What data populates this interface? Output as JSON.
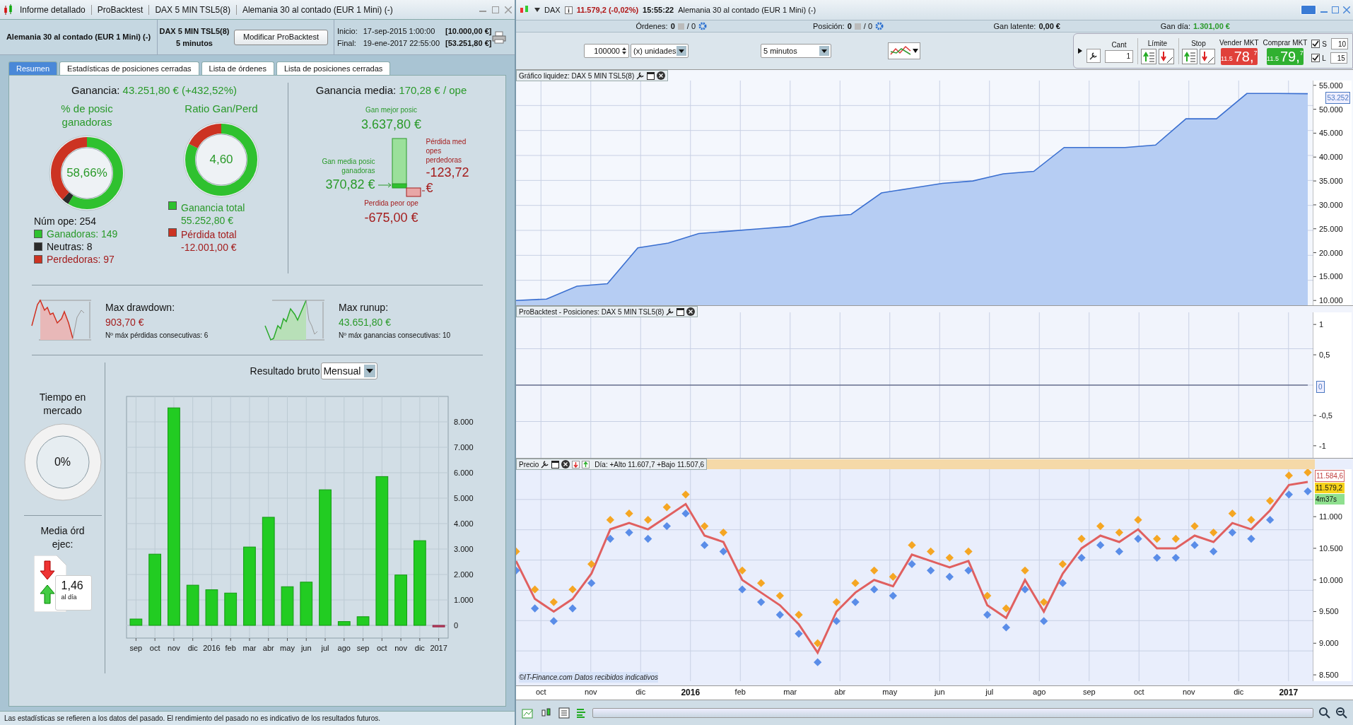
{
  "left_window": {
    "title_parts": [
      "Informe detallado",
      "ProBacktest",
      "DAX 5 MIN TSL5(8)",
      "Alemania 30 al contado (EUR 1 Mini) (-)"
    ],
    "instrument": "Alemania 30 al contado (EUR 1 Mini) (-)",
    "strategy": "DAX 5 MIN TSL5(8)",
    "timeframe": "5 minutos",
    "modify_button": "Modificar ProBacktest",
    "start_label": "Inicio:",
    "start_date": "17-sep-2015 1:00:00",
    "start_capital": "[10.000,00 €]",
    "end_label": "Final:",
    "end_date": "19-ene-2017 22:55:00",
    "end_capital": "[53.251,80 €]",
    "tabs": [
      {
        "label": "Resumen",
        "selected": true
      },
      {
        "label": "Estadísticas de posiciones cerradas",
        "selected": false
      },
      {
        "label": "Lista de órdenes",
        "selected": false
      },
      {
        "label": "Lista de posiciones cerradas",
        "selected": false
      }
    ],
    "summary": {
      "gain_label": "Ganancia:",
      "gain_value": "43.251,80 € (+432,52%)",
      "win_pct": {
        "title": "% de posic ganadoras",
        "value": "58,66%",
        "segments": [
          {
            "kind": "win",
            "level": 0.5866
          },
          {
            "kind": "neutral",
            "level": 0.0315
          },
          {
            "kind": "loss",
            "level": 0.3819
          }
        ]
      },
      "ratio": {
        "title": "Ratio Gan/Perd",
        "value": "4,60",
        "segments": [
          {
            "kind": "win",
            "level": 0.8216
          },
          {
            "kind": "loss",
            "level": 0.1784
          }
        ]
      },
      "trades_label": "Núm ope: 254",
      "legend_counts": [
        {
          "kind": "win",
          "label": "Ganadoras: 149"
        },
        {
          "kind": "neutral",
          "label": "Neutras: 8"
        },
        {
          "kind": "loss",
          "label": "Perdedoras: 97"
        }
      ],
      "legend_totals": [
        {
          "kind": "win",
          "label": "Ganancia total",
          "value": "55.252,80 €"
        },
        {
          "kind": "loss",
          "label": "Pérdida total",
          "value": "-12.001,00 €"
        }
      ],
      "avg_gain_label": "Ganancia media:",
      "avg_gain_value": "170,28 € / ope",
      "best_label": "Gan mejor posic",
      "best_value": "3.637,80 €",
      "avg_win_label": "Gan media posic ganadoras",
      "avg_win_value": "370,82 €",
      "avg_loss_label": "Pérdida med opes perdedoras",
      "avg_loss_value": "-123,72 €",
      "worst_label": "Perdida peor ope",
      "worst_value": "-675,00 €",
      "drawdown": {
        "label": "Max drawdown:",
        "value": "903,70 €",
        "note": "Nº máx pérdidas consecutivas: 6"
      },
      "runup": {
        "label": "Max runup:",
        "value": "43.651,80 €",
        "note": "Nº máx ganancias consecutivas: 10"
      },
      "time_in_market": {
        "title": "Tiempo en mercado",
        "value": "0%",
        "level": 0
      },
      "orders_per_day": {
        "title": "Media órd ejec:",
        "value": "1,46",
        "unit": "al día"
      },
      "result": {
        "label": "Resultado bruto",
        "period": "Mensual",
        "chart_data": {
          "type": "bar",
          "categories": [
            "sep",
            "oct",
            "nov",
            "dic",
            "2016",
            "feb",
            "mar",
            "abr",
            "may",
            "jun",
            "jul",
            "ago",
            "sep",
            "oct",
            "nov",
            "dic",
            "2017"
          ],
          "values": [
            250,
            2800,
            8550,
            1580,
            1400,
            1270,
            3080,
            4250,
            1520,
            1700,
            5330,
            150,
            340,
            5850,
            1980,
            3330,
            -60
          ],
          "grid": true,
          "ylim": [
            -500,
            9000
          ],
          "yticks": [
            {
              "value": 0,
              "label": "0"
            },
            {
              "value": 1000,
              "label": "1.000"
            },
            {
              "value": 2000,
              "label": "2.000"
            },
            {
              "value": 3000,
              "label": "3.000"
            },
            {
              "value": 4000,
              "label": "4.000"
            },
            {
              "value": 5000,
              "label": "5.000"
            },
            {
              "value": 6000,
              "label": "6.000"
            },
            {
              "value": 7000,
              "label": "7.000"
            },
            {
              "value": 8000,
              "label": "8.000"
            }
          ]
        }
      }
    },
    "status_bar": "Las estadísticas se refieren a los datos del pasado. El rendimiento del pasado no es indicativo de los resultados futuros."
  },
  "right_window": {
    "symbol": "DAX",
    "price": "11.579,2 (-0,02%)",
    "time": "15:55:22",
    "instrument": "Alemania 30 al contado (EUR 1 Mini) (-)",
    "account": {
      "orders_label": "Órdenes:",
      "orders_a": "0",
      "orders_b": "/ 0",
      "position_label": "Posición:",
      "position_a": "0",
      "position_b": "/ 0",
      "latent_label": "Gan latente:",
      "latent_value": "0,00 €",
      "day_label": "Gan día:",
      "day_value": "1.301,00 €"
    },
    "toolbar": {
      "quantity": "100000",
      "unit": "(x) unidades",
      "timeframe": "5 minutos"
    },
    "trade": {
      "qty_label": "Cant",
      "qty": "1",
      "limit_label": "Límite",
      "stop_label": "Stop",
      "sell": {
        "label": "Vender MKT",
        "prefix": "11.5",
        "big": "78,",
        "small": "7"
      },
      "buy": {
        "label": "Comprar MKT",
        "prefix": "11.5",
        "big": "79,",
        "small": "7"
      },
      "s": {
        "label": "S",
        "checked": true,
        "value": "10"
      },
      "l": {
        "label": "L",
        "checked": true,
        "value": "15"
      }
    },
    "equity_panel": {
      "title": "Gráfico liquidez: DAX 5 MIN TSL5(8)",
      "last_value": "53.252",
      "chart_data": {
        "type": "area",
        "grid": true,
        "values": [
          10000,
          10300,
          13000,
          13500,
          21000,
          22000,
          24000,
          24500,
          25000,
          25500,
          27500,
          28000,
          32500,
          33500,
          34500,
          35000,
          36500,
          37000,
          42000,
          42000,
          42000,
          42500,
          48000,
          48000,
          53300,
          53300,
          53250
        ],
        "ylim": [
          9000,
          56000
        ],
        "yticks": [
          {
            "value": 10000,
            "label": "10.000"
          },
          {
            "value": 15000,
            "label": "15.000"
          },
          {
            "value": 20000,
            "label": "20.000"
          },
          {
            "value": 25000,
            "label": "25.000"
          },
          {
            "value": 30000,
            "label": "30.000"
          },
          {
            "value": 35000,
            "label": "35.000"
          },
          {
            "value": 40000,
            "label": "40.000"
          },
          {
            "value": 45000,
            "label": "45.000"
          },
          {
            "value": 50000,
            "label": "50.000"
          },
          {
            "value": 55000,
            "label": "55.000"
          }
        ]
      }
    },
    "positions_panel": {
      "title": "ProBacktest - Posiciones: DAX 5 MIN TSL5(8)",
      "zero_label": "0",
      "chart_data": {
        "type": "line",
        "grid": true,
        "series": [
          {
            "color": "#333a60",
            "values": [
              0,
              0,
              0,
              0,
              0,
              0,
              0,
              0,
              0,
              0
            ]
          }
        ],
        "ylim": [
          -1.2,
          1.2
        ],
        "yticks": [
          {
            "value": 1,
            "label": "1"
          },
          {
            "value": 0.5,
            "label": "0,5"
          },
          {
            "value": -0.5,
            "label": "-0,5"
          },
          {
            "value": -1,
            "label": "-1"
          }
        ]
      }
    },
    "price_panel": {
      "title": "Precio",
      "day_info": "Día: +Alto 11.607,7 +Bajo 11.507,6",
      "copyright": "©IT-Finance.com Datos recibidos indicativos",
      "high_label": "11.584,6",
      "last_label": "11.579,2",
      "countdown": "4m37s",
      "chart_data": {
        "type": "line",
        "grid": true,
        "series": [
          {
            "color": "#e06060",
            "values": [
              10300,
              9700,
              9500,
              9700,
              10100,
              10800,
              10900,
              10800,
              11000,
              11200,
              10700,
              10600,
              10000,
              9800,
              9600,
              9300,
              8850,
              9500,
              9800,
              10000,
              9900,
              10400,
              10300,
              10200,
              10300,
              9600,
              9400,
              10000,
              9500,
              10100,
              10500,
              10700,
              10600,
              10800,
              10500,
              10500,
              10700,
              10600,
              10900,
              10800,
              11100,
              11500,
              11550
            ]
          },
          {
            "color": "#f5a623",
            "type": "scatter",
            "values": [
              10450,
              9850,
              9650,
              9850,
              10250,
              10950,
              11050,
              10950,
              11150,
              11350,
              10850,
              10750,
              10150,
              9950,
              9750,
              9450,
              9000,
              9650,
              9950,
              10150,
              10050,
              10550,
              10450,
              10350,
              10450,
              9750,
              9550,
              10150,
              9650,
              10250,
              10650,
              10850,
              10750,
              10950,
              10650,
              10650,
              10850,
              10750,
              11050,
              10950,
              11250,
              11650,
              11700
            ]
          },
          {
            "color": "#5a8de8",
            "type": "scatter",
            "values": [
              10150,
              9550,
              9350,
              9550,
              9950,
              10650,
              10750,
              10650,
              10850,
              11050,
              10550,
              10450,
              9850,
              9650,
              9450,
              9150,
              8700,
              9350,
              9650,
              9850,
              9750,
              10250,
              10150,
              10050,
              10150,
              9450,
              9250,
              9850,
              9350,
              9950,
              10350,
              10550,
              10450,
              10650,
              10350,
              10350,
              10550,
              10450,
              10750,
              10650,
              10950,
              11350,
              11400
            ]
          }
        ],
        "ylim": [
          8400,
          11750
        ],
        "yticks": [
          {
            "value": 8500,
            "label": "8.500"
          },
          {
            "value": 9000,
            "label": "9.000"
          },
          {
            "value": 9500,
            "label": "9.500"
          },
          {
            "value": 10000,
            "label": "10.000"
          },
          {
            "value": 10500,
            "label": "10.500"
          },
          {
            "value": 11000,
            "label": "11.000"
          }
        ]
      }
    },
    "time_axis": [
      {
        "label": "oct",
        "kind": "month"
      },
      {
        "label": "nov",
        "kind": "month"
      },
      {
        "label": "dic",
        "kind": "month"
      },
      {
        "label": "2016",
        "kind": "year"
      },
      {
        "label": "feb",
        "kind": "month"
      },
      {
        "label": "mar",
        "kind": "month"
      },
      {
        "label": "abr",
        "kind": "month"
      },
      {
        "label": "may",
        "kind": "month"
      },
      {
        "label": "jun",
        "kind": "month"
      },
      {
        "label": "jul",
        "kind": "month"
      },
      {
        "label": "ago",
        "kind": "month"
      },
      {
        "label": "sep",
        "kind": "month"
      },
      {
        "label": "oct",
        "kind": "month"
      },
      {
        "label": "nov",
        "kind": "month"
      },
      {
        "label": "dic",
        "kind": "month"
      },
      {
        "label": "2017",
        "kind": "year"
      }
    ]
  }
}
